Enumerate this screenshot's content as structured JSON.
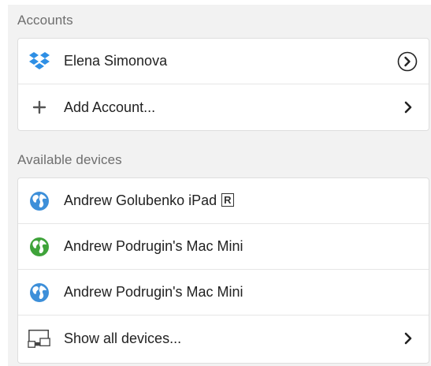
{
  "accounts": {
    "header": "Accounts",
    "items": [
      {
        "label": "Elena Simonova",
        "icon": "dropbox-icon"
      },
      {
        "label": "Add Account...",
        "icon": "plus-icon"
      }
    ]
  },
  "devices": {
    "header": "Available devices",
    "items": [
      {
        "label": "Andrew Golubenko iPad",
        "badge": "R",
        "icon": "globe-icon",
        "color": "#3d8fd9"
      },
      {
        "label": "Andrew Podrugin's Mac Mini",
        "icon": "globe-icon",
        "color": "#3fa33a"
      },
      {
        "label": "Andrew Podrugin's Mac Mini",
        "icon": "globe-icon",
        "color": "#3d8fd9"
      },
      {
        "label": "Show all devices...",
        "icon": "monitor-icon"
      }
    ]
  },
  "colors": {
    "dropbox": "#2e8fe5",
    "globe_blue": "#3d8fd9",
    "globe_green": "#3fa33a"
  }
}
